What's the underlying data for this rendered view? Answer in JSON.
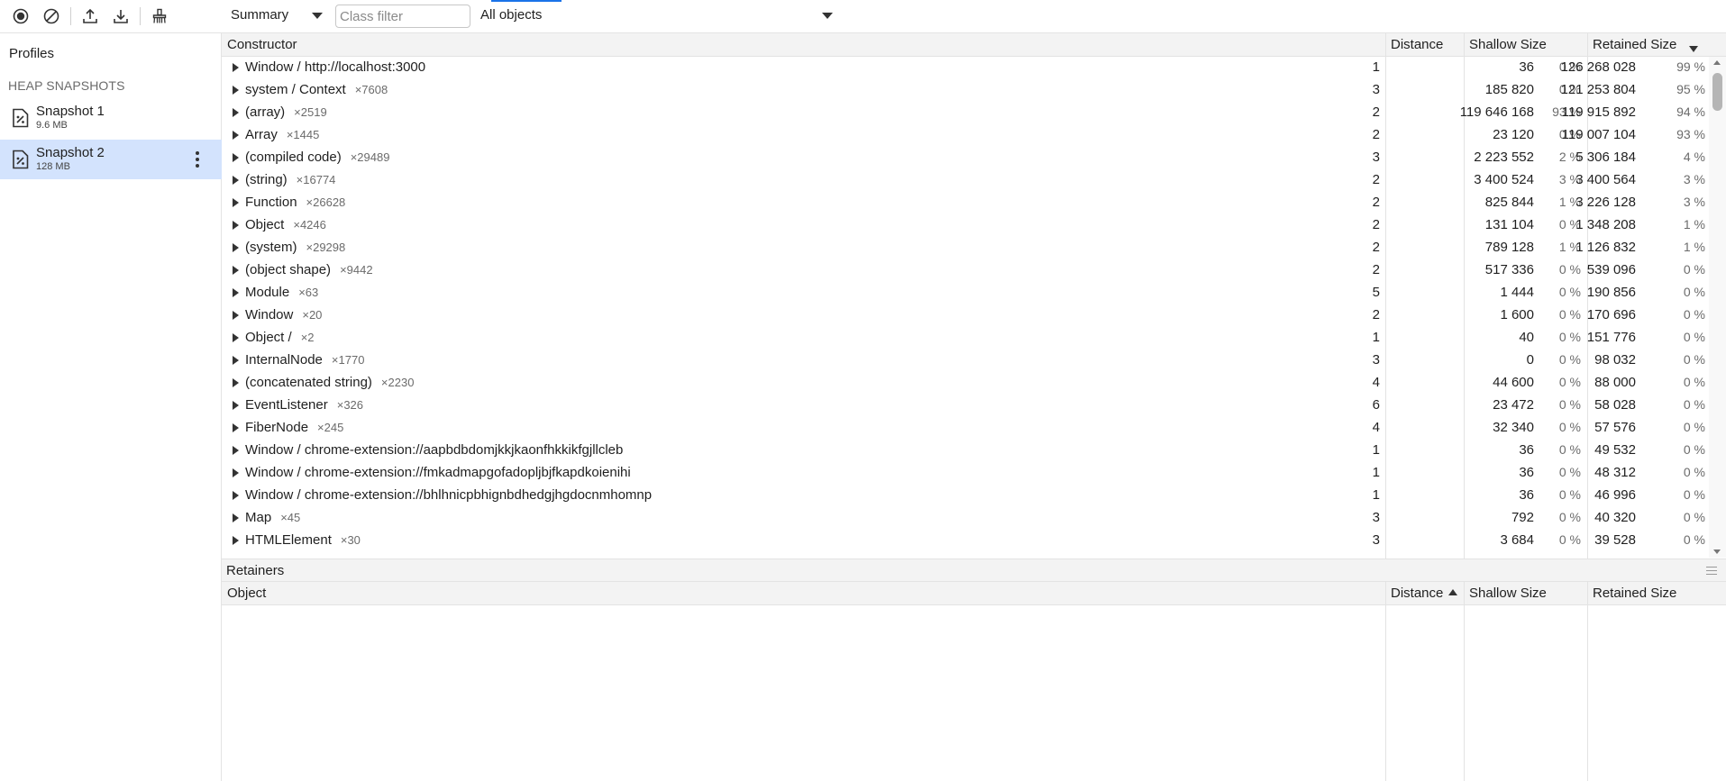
{
  "sidebar": {
    "profiles_title": "Profiles",
    "section_title": "HEAP SNAPSHOTS",
    "snapshots": [
      {
        "name": "Snapshot 1",
        "size": "9.6 MB"
      },
      {
        "name": "Snapshot 2",
        "size": "128 MB",
        "selected": true
      }
    ]
  },
  "toolbar": {
    "icons": [
      "record-icon",
      "clear-icon",
      "upload-icon",
      "download-icon",
      "collect-garbage-icon"
    ],
    "view_select": "Summary",
    "class_filter_placeholder": "Class filter",
    "objects_select": "All objects"
  },
  "summary_grid": {
    "columns": {
      "constructor": "Constructor",
      "distance": "Distance",
      "shallow": "Shallow Size",
      "retained": "Retained Size"
    },
    "sort": {
      "column": "retained",
      "direction": "descending"
    },
    "rows": [
      {
        "name": "Window / http://localhost:3000",
        "count": "",
        "distance": "1",
        "shallow": "36",
        "shallow_pct": "0 %",
        "retained": "126 268 028",
        "retained_pct": "99 %"
      },
      {
        "name": "system / Context",
        "count": "×7608",
        "distance": "3",
        "shallow": "185 820",
        "shallow_pct": "0 %",
        "retained": "121 253 804",
        "retained_pct": "95 %"
      },
      {
        "name": "(array)",
        "count": "×2519",
        "distance": "2",
        "shallow": "119 646 168",
        "shallow_pct": "93 %",
        "retained": "119 915 892",
        "retained_pct": "94 %"
      },
      {
        "name": "Array",
        "count": "×1445",
        "distance": "2",
        "shallow": "23 120",
        "shallow_pct": "0 %",
        "retained": "119 007 104",
        "retained_pct": "93 %"
      },
      {
        "name": "(compiled code)",
        "count": "×29489",
        "distance": "3",
        "shallow": "2 223 552",
        "shallow_pct": "2 %",
        "retained": "5 306 184",
        "retained_pct": "4 %"
      },
      {
        "name": "(string)",
        "count": "×16774",
        "distance": "2",
        "shallow": "3 400 524",
        "shallow_pct": "3 %",
        "retained": "3 400 564",
        "retained_pct": "3 %"
      },
      {
        "name": "Function",
        "count": "×26628",
        "distance": "2",
        "shallow": "825 844",
        "shallow_pct": "1 %",
        "retained": "3 226 128",
        "retained_pct": "3 %"
      },
      {
        "name": "Object",
        "count": "×4246",
        "distance": "2",
        "shallow": "131 104",
        "shallow_pct": "0 %",
        "retained": "1 348 208",
        "retained_pct": "1 %"
      },
      {
        "name": "(system)",
        "count": "×29298",
        "distance": "2",
        "shallow": "789 128",
        "shallow_pct": "1 %",
        "retained": "1 126 832",
        "retained_pct": "1 %"
      },
      {
        "name": "(object shape)",
        "count": "×9442",
        "distance": "2",
        "shallow": "517 336",
        "shallow_pct": "0 %",
        "retained": "539 096",
        "retained_pct": "0 %"
      },
      {
        "name": "Module",
        "count": "×63",
        "distance": "5",
        "shallow": "1 444",
        "shallow_pct": "0 %",
        "retained": "190 856",
        "retained_pct": "0 %"
      },
      {
        "name": "Window",
        "count": "×20",
        "distance": "2",
        "shallow": "1 600",
        "shallow_pct": "0 %",
        "retained": "170 696",
        "retained_pct": "0 %"
      },
      {
        "name": "Object /",
        "count": "×2",
        "distance": "1",
        "shallow": "40",
        "shallow_pct": "0 %",
        "retained": "151 776",
        "retained_pct": "0 %"
      },
      {
        "name": "InternalNode",
        "count": "×1770",
        "distance": "3",
        "shallow": "0",
        "shallow_pct": "0 %",
        "retained": "98 032",
        "retained_pct": "0 %"
      },
      {
        "name": "(concatenated string)",
        "count": "×2230",
        "distance": "4",
        "shallow": "44 600",
        "shallow_pct": "0 %",
        "retained": "88 000",
        "retained_pct": "0 %"
      },
      {
        "name": "EventListener",
        "count": "×326",
        "distance": "6",
        "shallow": "23 472",
        "shallow_pct": "0 %",
        "retained": "58 028",
        "retained_pct": "0 %"
      },
      {
        "name": "FiberNode",
        "count": "×245",
        "distance": "4",
        "shallow": "32 340",
        "shallow_pct": "0 %",
        "retained": "57 576",
        "retained_pct": "0 %"
      },
      {
        "name": "Window / chrome-extension://aapbdbdomjkkjkaonfhkkikfgjllcleb",
        "count": "",
        "distance": "1",
        "shallow": "36",
        "shallow_pct": "0 %",
        "retained": "49 532",
        "retained_pct": "0 %"
      },
      {
        "name": "Window / chrome-extension://fmkadmapgofadopljbjfkapdkoienihi",
        "count": "",
        "distance": "1",
        "shallow": "36",
        "shallow_pct": "0 %",
        "retained": "48 312",
        "retained_pct": "0 %"
      },
      {
        "name": "Window / chrome-extension://bhlhnicpbhignbdhedgjhgdocnmhomnp",
        "count": "",
        "distance": "1",
        "shallow": "36",
        "shallow_pct": "0 %",
        "retained": "46 996",
        "retained_pct": "0 %"
      },
      {
        "name": "Map",
        "count": "×45",
        "distance": "3",
        "shallow": "792",
        "shallow_pct": "0 %",
        "retained": "40 320",
        "retained_pct": "0 %"
      },
      {
        "name": "HTMLElement",
        "count": "×30",
        "distance": "3",
        "shallow": "3 684",
        "shallow_pct": "0 %",
        "retained": "39 528",
        "retained_pct": "0 %"
      }
    ]
  },
  "retainers": {
    "title": "Retainers",
    "columns": {
      "object": "Object",
      "distance": "Distance",
      "shallow": "Shallow Size",
      "retained": "Retained Size"
    },
    "sort": {
      "column": "distance",
      "direction": "ascending"
    }
  }
}
